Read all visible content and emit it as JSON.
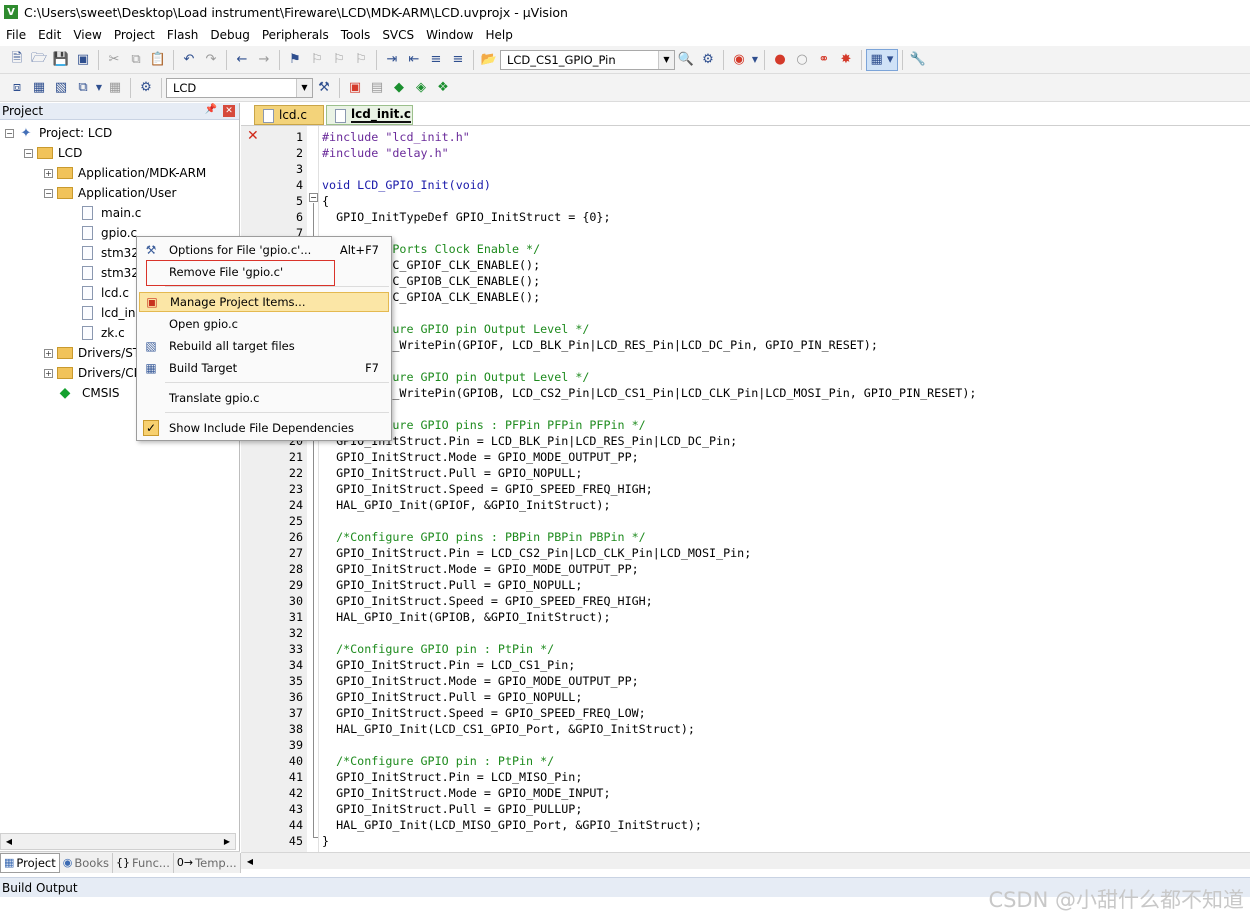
{
  "window": {
    "title": "C:\\Users\\sweet\\Desktop\\Load instrument\\Fireware\\LCD\\MDK-ARM\\LCD.uvprojx - µVision"
  },
  "menu": [
    "File",
    "Edit",
    "View",
    "Project",
    "Flash",
    "Debug",
    "Peripherals",
    "Tools",
    "SVCS",
    "Window",
    "Help"
  ],
  "toolbar": {
    "find_combo": "LCD_CS1_GPIO_Pin",
    "target_combo": "LCD"
  },
  "project_panel": {
    "title": "Project",
    "tree": [
      {
        "label": "Project: LCD"
      },
      {
        "label": "LCD"
      },
      {
        "label": "Application/MDK-ARM"
      },
      {
        "label": "Application/User"
      },
      {
        "label": "main.c"
      },
      {
        "label": "gpio.c"
      },
      {
        "label": "stm32f"
      },
      {
        "label": "stm32f"
      },
      {
        "label": "lcd.c"
      },
      {
        "label": "lcd_ini"
      },
      {
        "label": "zk.c"
      },
      {
        "label": "Drivers/ST"
      },
      {
        "label": "Drivers/CM"
      },
      {
        "label": "CMSIS"
      }
    ],
    "tabs": [
      "Project",
      "Books",
      "Func...",
      "Temp..."
    ]
  },
  "editor": {
    "tabs": [
      "lcd.c",
      "lcd_init.c"
    ],
    "active_tab": "lcd_init.c",
    "lines": [
      {
        "n": "1",
        "t": "#include \"lcd_init.h\"",
        "c": "pp"
      },
      {
        "n": "2",
        "t": "#include \"delay.h\"",
        "c": "pp"
      },
      {
        "n": "3",
        "t": "",
        "c": ""
      },
      {
        "n": "4",
        "t": "void LCD_GPIO_Init(void)",
        "c": "kw"
      },
      {
        "n": "5",
        "t": "{",
        "c": ""
      },
      {
        "n": "6",
        "t": "  GPIO_InitTypeDef GPIO_InitStruct = {0};",
        "c": ""
      },
      {
        "n": "7",
        "t": "",
        "c": ""
      },
      {
        "n": "8",
        "t": "  /* GPIO Ports Clock Enable */",
        "c": "comment"
      },
      {
        "n": "9",
        "t": "  __HAL_RCC_GPIOF_CLK_ENABLE();",
        "c": ""
      },
      {
        "n": "10",
        "t": "  __HAL_RCC_GPIOB_CLK_ENABLE();",
        "c": ""
      },
      {
        "n": "11",
        "t": "  __HAL_RCC_GPIOA_CLK_ENABLE();",
        "c": ""
      },
      {
        "n": "12",
        "t": "",
        "c": ""
      },
      {
        "n": "13",
        "t": "  /*Configure GPIO pin Output Level */",
        "c": "comment"
      },
      {
        "n": "14",
        "t": "  HAL_GPIO_WritePin(GPIOF, LCD_BLK_Pin|LCD_RES_Pin|LCD_DC_Pin, GPIO_PIN_RESET);",
        "c": ""
      },
      {
        "n": "15",
        "t": "",
        "c": ""
      },
      {
        "n": "16",
        "t": "  /*Configure GPIO pin Output Level */",
        "c": "comment"
      },
      {
        "n": "17",
        "t": "  HAL_GPIO_WritePin(GPIOB, LCD_CS2_Pin|LCD_CS1_Pin|LCD_CLK_Pin|LCD_MOSI_Pin, GPIO_PIN_RESET);",
        "c": ""
      },
      {
        "n": "18",
        "t": "",
        "c": ""
      },
      {
        "n": "19",
        "t": "  /*Configure GPIO pins : PFPin PFPin PFPin */",
        "c": "comment"
      },
      {
        "n": "20",
        "t": "  GPIO_InitStruct.Pin = LCD_BLK_Pin|LCD_RES_Pin|LCD_DC_Pin;",
        "c": ""
      },
      {
        "n": "21",
        "t": "  GPIO_InitStruct.Mode = GPIO_MODE_OUTPUT_PP;",
        "c": ""
      },
      {
        "n": "22",
        "t": "  GPIO_InitStruct.Pull = GPIO_NOPULL;",
        "c": ""
      },
      {
        "n": "23",
        "t": "  GPIO_InitStruct.Speed = GPIO_SPEED_FREQ_HIGH;",
        "c": ""
      },
      {
        "n": "24",
        "t": "  HAL_GPIO_Init(GPIOF, &GPIO_InitStruct);",
        "c": ""
      },
      {
        "n": "25",
        "t": "",
        "c": ""
      },
      {
        "n": "26",
        "t": "  /*Configure GPIO pins : PBPin PBPin PBPin */",
        "c": "comment"
      },
      {
        "n": "27",
        "t": "  GPIO_InitStruct.Pin = LCD_CS2_Pin|LCD_CLK_Pin|LCD_MOSI_Pin;",
        "c": ""
      },
      {
        "n": "28",
        "t": "  GPIO_InitStruct.Mode = GPIO_MODE_OUTPUT_PP;",
        "c": ""
      },
      {
        "n": "29",
        "t": "  GPIO_InitStruct.Pull = GPIO_NOPULL;",
        "c": ""
      },
      {
        "n": "30",
        "t": "  GPIO_InitStruct.Speed = GPIO_SPEED_FREQ_HIGH;",
        "c": ""
      },
      {
        "n": "31",
        "t": "  HAL_GPIO_Init(GPIOB, &GPIO_InitStruct);",
        "c": ""
      },
      {
        "n": "32",
        "t": "",
        "c": ""
      },
      {
        "n": "33",
        "t": "  /*Configure GPIO pin : PtPin */",
        "c": "comment"
      },
      {
        "n": "34",
        "t": "  GPIO_InitStruct.Pin = LCD_CS1_Pin;",
        "c": ""
      },
      {
        "n": "35",
        "t": "  GPIO_InitStruct.Mode = GPIO_MODE_OUTPUT_PP;",
        "c": ""
      },
      {
        "n": "36",
        "t": "  GPIO_InitStruct.Pull = GPIO_NOPULL;",
        "c": ""
      },
      {
        "n": "37",
        "t": "  GPIO_InitStruct.Speed = GPIO_SPEED_FREQ_LOW;",
        "c": ""
      },
      {
        "n": "38",
        "t": "  HAL_GPIO_Init(LCD_CS1_GPIO_Port, &GPIO_InitStruct);",
        "c": ""
      },
      {
        "n": "39",
        "t": "",
        "c": ""
      },
      {
        "n": "40",
        "t": "  /*Configure GPIO pin : PtPin */",
        "c": "comment"
      },
      {
        "n": "41",
        "t": "  GPIO_InitStruct.Pin = LCD_MISO_Pin;",
        "c": ""
      },
      {
        "n": "42",
        "t": "  GPIO_InitStruct.Mode = GPIO_MODE_INPUT;",
        "c": ""
      },
      {
        "n": "43",
        "t": "  GPIO_InitStruct.Pull = GPIO_PULLUP;",
        "c": ""
      },
      {
        "n": "44",
        "t": "  HAL_GPIO_Init(LCD_MISO_GPIO_Port, &GPIO_InitStruct);",
        "c": ""
      },
      {
        "n": "45",
        "t": "}",
        "c": ""
      }
    ]
  },
  "context_menu": {
    "items": [
      {
        "label": "Options for File 'gpio.c'...",
        "shortcut": "Alt+F7",
        "icon": "options-icon"
      },
      {
        "label": "Remove File 'gpio.c'",
        "shortcut": "",
        "icon": ""
      },
      {
        "label": "Manage Project Items...",
        "shortcut": "",
        "icon": "manage-items-icon"
      },
      {
        "label": "Open gpio.c",
        "shortcut": "",
        "icon": ""
      },
      {
        "label": "Rebuild all target files",
        "shortcut": "",
        "icon": "rebuild-icon"
      },
      {
        "label": "Build Target",
        "shortcut": "F7",
        "icon": "build-icon"
      },
      {
        "label": "Translate gpio.c",
        "shortcut": "",
        "icon": ""
      },
      {
        "label": "Show Include File Dependencies",
        "shortcut": "",
        "icon": "checkmark-icon"
      }
    ]
  },
  "build_output": {
    "title": "Build Output"
  },
  "watermark": "CSDN @小甜什么都不知道",
  "colors": {
    "comment": "#1e8b1e",
    "preprocessor": "#6a2b9a",
    "keyword": "#1a1aaa",
    "highlight": "#fbe6a6",
    "annotation_red": "#d9332a"
  }
}
